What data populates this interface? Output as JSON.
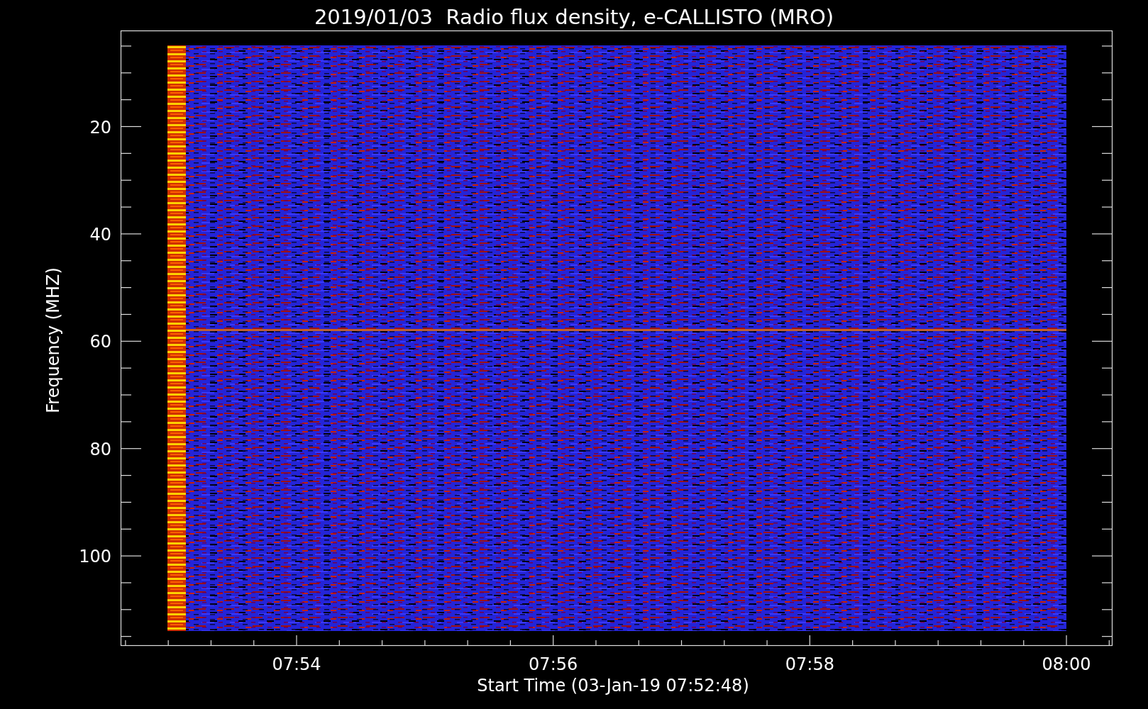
{
  "title": "2019/01/03  Radio flux density, e-CALLISTO (MRO)",
  "xlabel": "Start Time (03-Jan-19 07:52:48)",
  "ylabel": "Frequency (MHZ)",
  "x_tick_labels": [
    "07:54",
    "07:56",
    "07:58",
    "08:00"
  ],
  "y_tick_labels": [
    "20",
    "40",
    "60",
    "80",
    "100"
  ],
  "spectrogram": {
    "kind": "picture"
  }
}
